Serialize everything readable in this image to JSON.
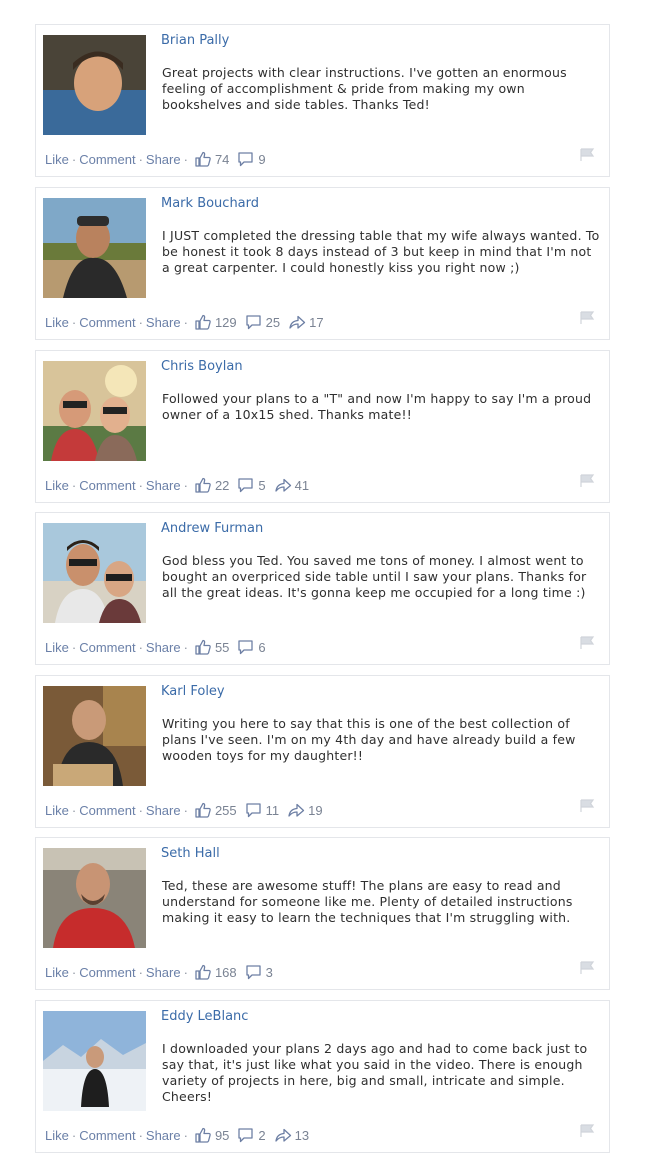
{
  "actions": {
    "like": "Like",
    "comment": "Comment",
    "share": "Share",
    "separator": "·"
  },
  "colors": {
    "link": "#3b6ba8",
    "action": "#6b80a8",
    "icon": "#6d7fa4",
    "border": "#e4e6ea"
  },
  "icons": {
    "like": "thumbs-up-icon",
    "comment": "comment-icon",
    "share": "share-icon",
    "flag": "flag-icon"
  },
  "comments": [
    {
      "name": "Brian Pally",
      "text": "Great projects with clear instructions. I've gotten an enormous feeling of accomplishment & pride from making my own bookshelves and side tables. Thanks Ted!",
      "likes": "74",
      "comments": "9",
      "shares": ""
    },
    {
      "name": "Mark Bouchard",
      "text": "I JUST completed the dressing table that my wife always wanted. To be honest it took 8 days instead of 3 but keep in mind that I'm not a great carpenter. I could honestly kiss you right now ;)",
      "likes": "129",
      "comments": "25",
      "shares": "17"
    },
    {
      "name": "Chris Boylan",
      "text": "Followed your plans to a \"T\" and now I'm happy to say I'm a proud owner of a 10x15 shed. Thanks mate!!",
      "likes": "22",
      "comments": "5",
      "shares": "41"
    },
    {
      "name": "Andrew Furman",
      "text": "God bless you Ted. You saved me tons of money. I almost went to bought an overpriced side table until I saw your plans. Thanks for all the great ideas. It's gonna keep me occupied for a long time :)",
      "likes": "55",
      "comments": "6",
      "shares": ""
    },
    {
      "name": "Karl Foley",
      "text": "Writing you here to say that this is one of the best collection of plans I've seen. I'm on my 4th day and have already build a few wooden toys for my daughter!!",
      "likes": "255",
      "comments": "11",
      "shares": "19"
    },
    {
      "name": "Seth Hall",
      "text": "Ted, these are awesome stuff! The plans are easy to read and understand for someone like me. Plenty of detailed instructions making it easy to learn the techniques that I'm struggling with.",
      "likes": "168",
      "comments": "3",
      "shares": ""
    },
    {
      "name": "Eddy LeBlanc",
      "text": "I downloaded your plans 2 days ago and had to come back just to say that, it's just like what you said in the video. There is enough variety of projects in here, big and small, intricate and simple. Cheers!",
      "likes": "95",
      "comments": "2",
      "shares": "13"
    }
  ]
}
